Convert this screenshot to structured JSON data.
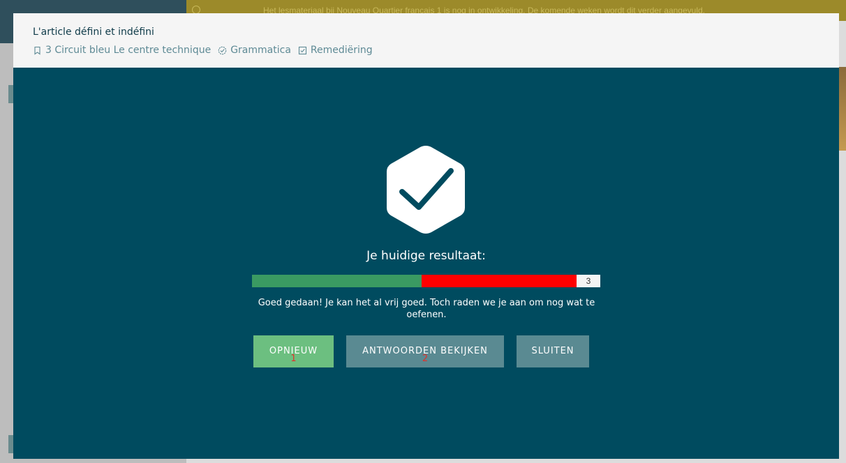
{
  "background": {
    "banner_text": "Het lesmateriaal bij Nouveau Quartier français 1 is nog in ontwikkeling. De komende weken wordt dit verder aangevuld."
  },
  "modal": {
    "title": "L'article défini et indéfini",
    "meta": [
      {
        "icon": "bookmark-icon",
        "label": "3 Circuit bleu Le centre technique"
      },
      {
        "icon": "check-badge-icon",
        "label": "Grammatica"
      },
      {
        "icon": "checkbox-icon",
        "label": "Remediëring"
      }
    ]
  },
  "result": {
    "icon": "checkmark-hexagon-icon",
    "title": "Je huidige resultaat:",
    "score": {
      "good_fraction": 0.487,
      "bad_fraction": 0.445,
      "count_label": "3",
      "colors": {
        "good": "#3a9a62",
        "bad": "#ff0000"
      }
    },
    "message": "Goed gedaan! Je kan het al vrij goed. Toch raden we je aan om nog wat te oefenen."
  },
  "buttons": {
    "retry": {
      "label": "OPNIEUW",
      "hint": "1"
    },
    "answers": {
      "label": "ANTWOORDEN BEKIJKEN",
      "hint": "2"
    },
    "close": {
      "label": "SLUITEN"
    }
  },
  "colors": {
    "modal_bg": "#004b5f",
    "header_bg": "#f5f5f5",
    "retry_button": "#6cbf80",
    "secondary_button": "#5a8a92"
  }
}
